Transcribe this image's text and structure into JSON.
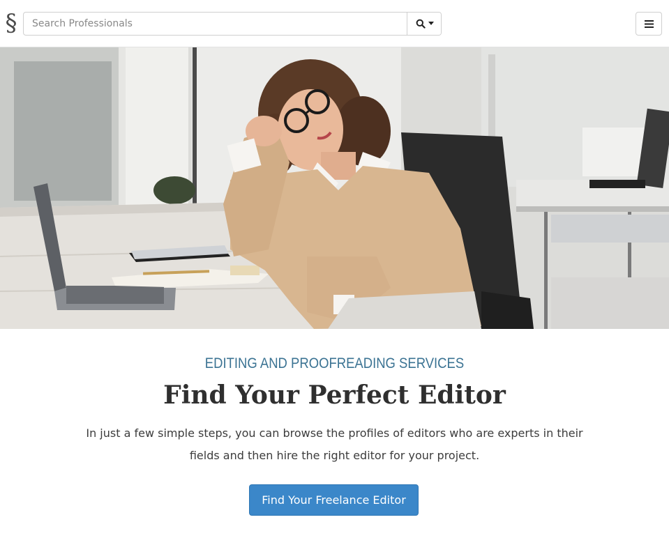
{
  "brand": {
    "logo_glyph": "§",
    "logo_icon": "section-sign-logo-icon"
  },
  "search": {
    "placeholder": "Search Professionals",
    "value": "",
    "button_icon": "search-icon",
    "dropdown_icon": "caret-down-icon"
  },
  "menu": {
    "icon": "hamburger-menu-icon"
  },
  "hero": {
    "image": "photo-woman-at-desk-with-laptop"
  },
  "main": {
    "eyebrow": "EDITING AND PROOFREADING SERVICES",
    "headline": "Find Your Perfect Editor",
    "lead": "In just a few simple steps, you can browse the profiles of editors who are experts in their fields and then hire the right editor for your project.",
    "cta_label": "Find Your Freelance Editor"
  },
  "colors": {
    "accent": "#3b87c9",
    "eyebrow": "#3b7393",
    "headline": "#2f2f2f"
  }
}
